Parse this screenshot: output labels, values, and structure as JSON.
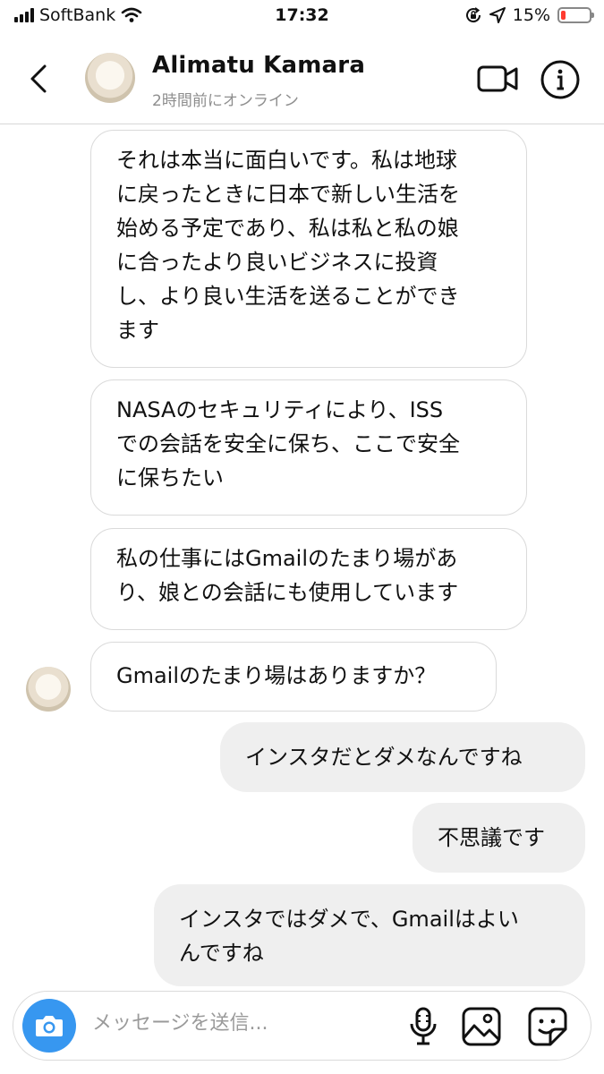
{
  "status_bar": {
    "carrier": "SoftBank",
    "time": "17:32",
    "battery": "15%",
    "battery_level": 0.15,
    "icons": [
      "signal-icon",
      "wifi-icon",
      "orientation-lock-icon",
      "location-icon",
      "battery-icon"
    ]
  },
  "header": {
    "name": "Alimatu Kamara",
    "status": "2時間前にオンライン",
    "icons": [
      "back-icon",
      "video-call-icon",
      "info-icon"
    ]
  },
  "messages": [
    {
      "direction": "incoming",
      "text": "それは本当に面白いです。私は地球\nに戻ったときに日本で新しい生活を\n始める予定であり、私は私と私の娘\nに合ったより良いビジネスに投資\nし、より良い生活を送ることができ\nます"
    },
    {
      "direction": "incoming",
      "text": "NASAのセキュリティにより、ISS\nでの会話を安全に保ち、ここで安全\nに保ちたい"
    },
    {
      "direction": "incoming",
      "text": "私の仕事にはGmailのたまり場があ\nり、娘との会話にも使用しています"
    },
    {
      "direction": "incoming",
      "text": "Gmailのたまり場はありますか？"
    },
    {
      "direction": "outgoing",
      "text": "インスタだとダメなんですね"
    },
    {
      "direction": "outgoing",
      "text": "不思議です"
    },
    {
      "direction": "outgoing",
      "text": "インスタではダメで、Gmailはよい\nんですね"
    }
  ],
  "composer": {
    "placeholder": "メッセージを送信...",
    "icons": [
      "camera-icon",
      "microphone-icon",
      "photo-gallery-icon",
      "sticker-icon"
    ]
  },
  "colors": {
    "accent": "#3797f0",
    "incoming_border": "#dadada",
    "outgoing_bg": "#efefef",
    "battery_low": "#ff3b30",
    "secondary_text": "#8e8e8e"
  }
}
